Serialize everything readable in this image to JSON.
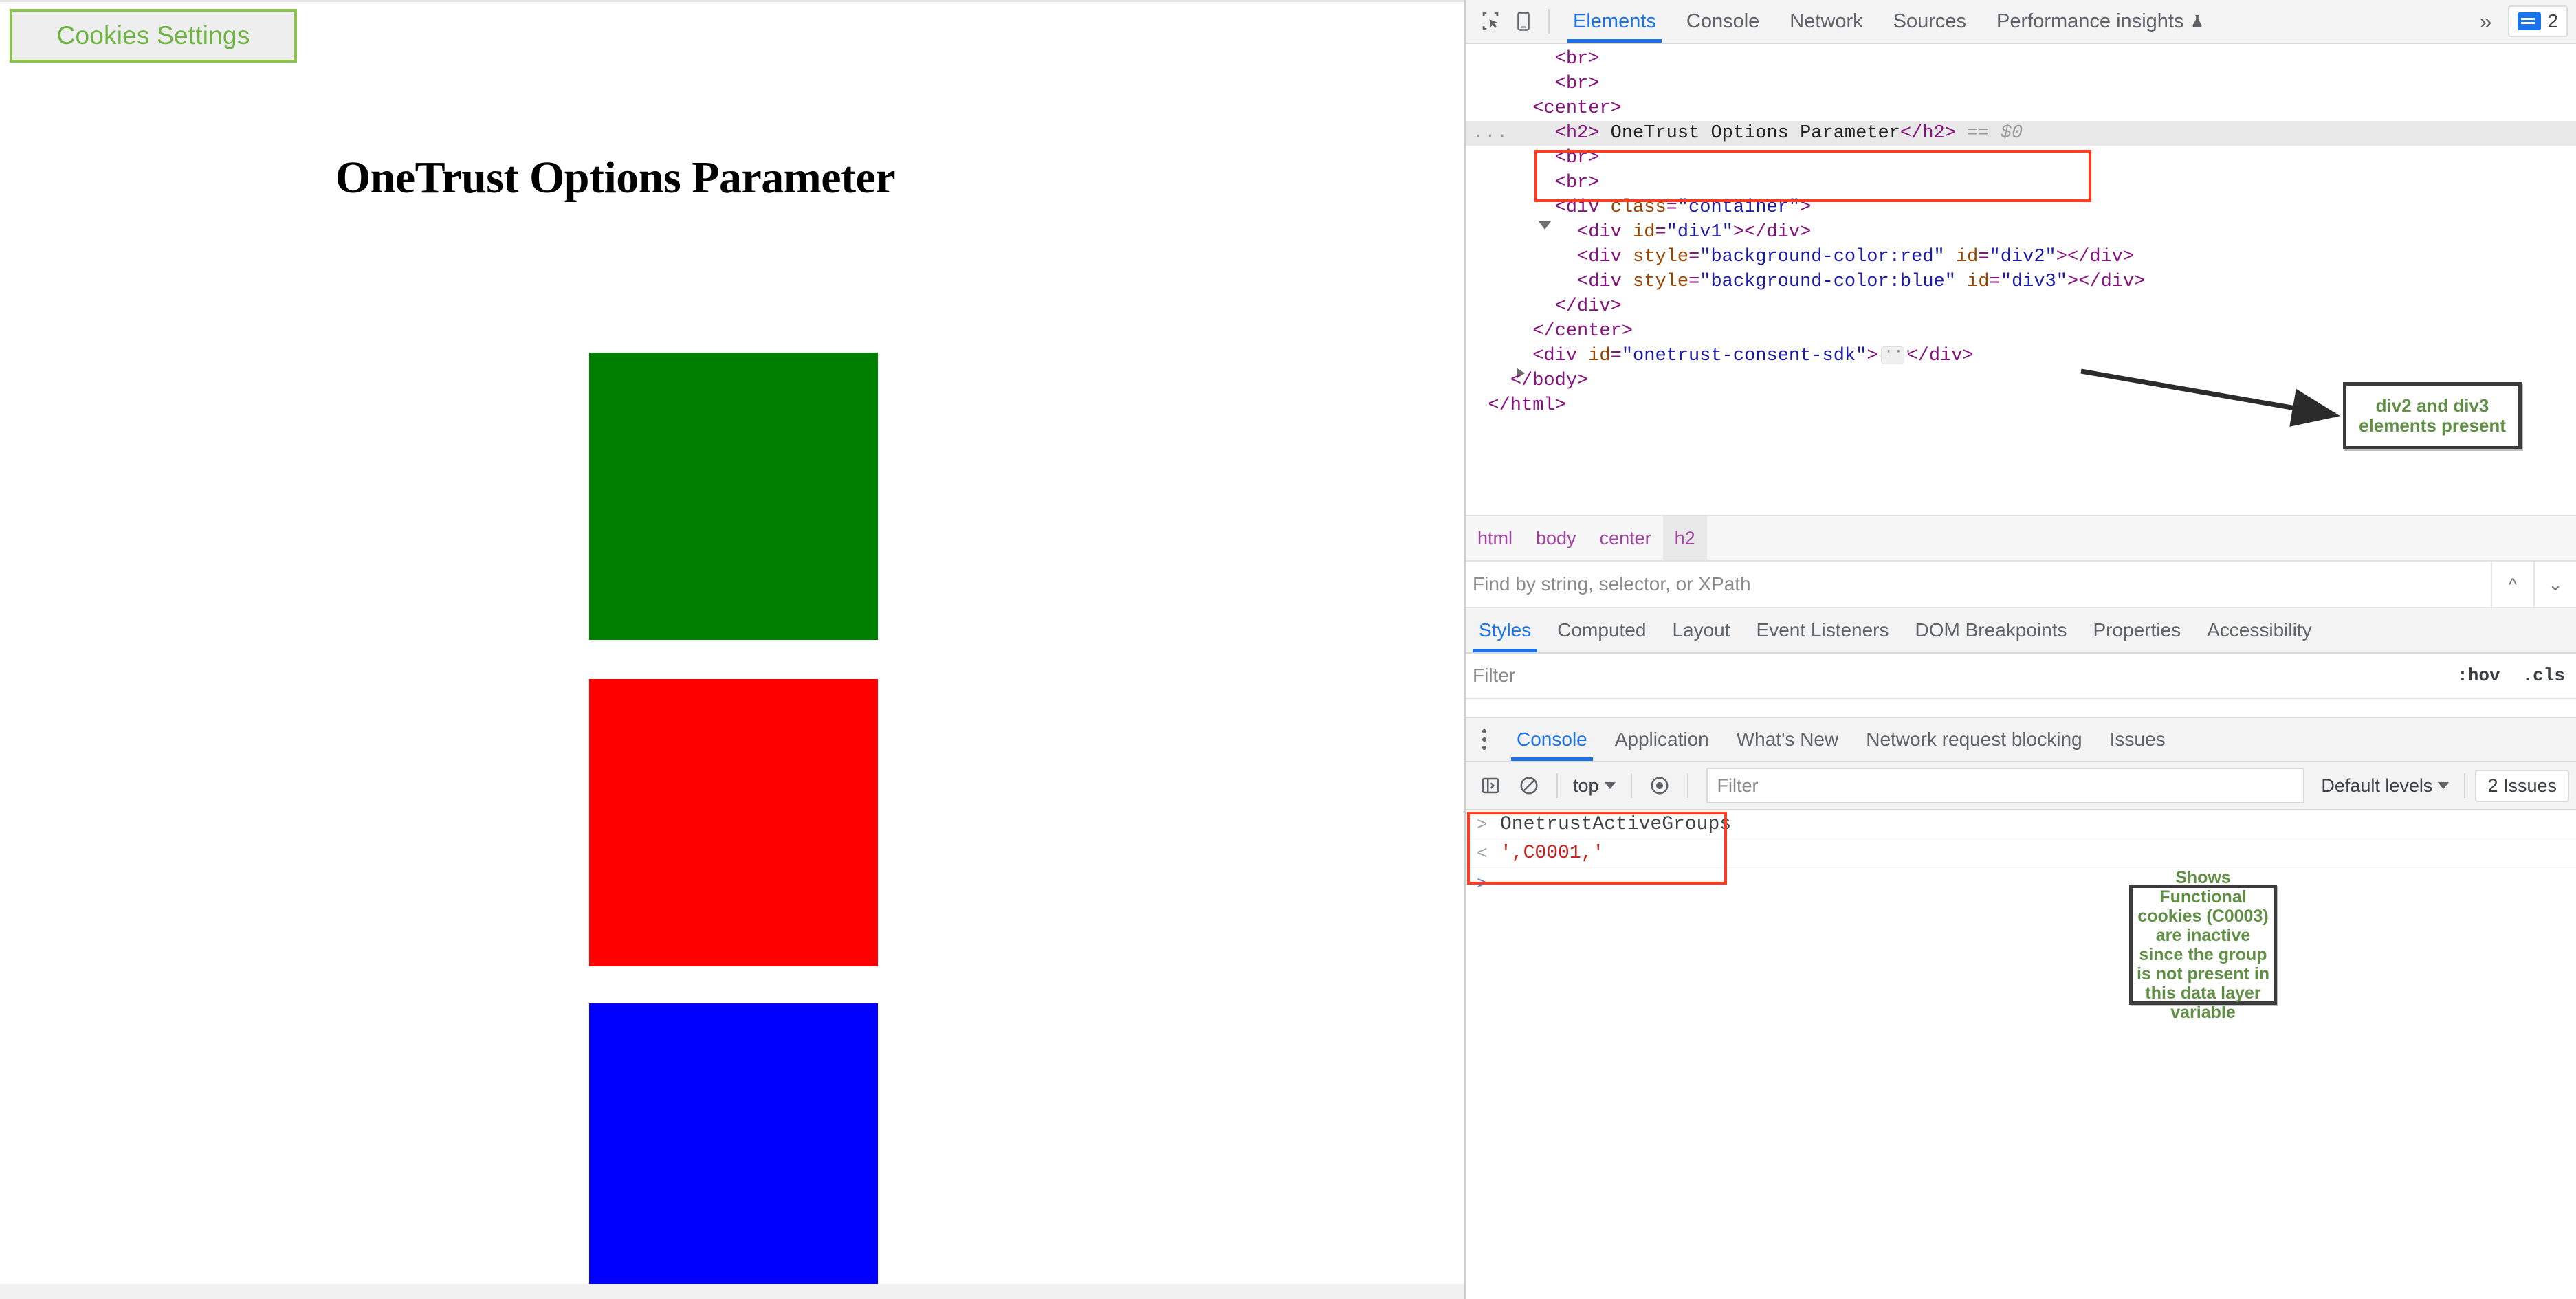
{
  "page": {
    "cookies_button_label": "Cookies Settings",
    "title": "OneTrust Options Parameter",
    "blocks": [
      {
        "id": "div1",
        "color": "#008000",
        "name": "green-block"
      },
      {
        "id": "div2",
        "color": "#ff0000",
        "name": "red-block"
      },
      {
        "id": "div3",
        "color": "#0000ff",
        "name": "blue-block"
      }
    ]
  },
  "devtools": {
    "toolbar": {
      "tabs": [
        {
          "label": "Elements",
          "active": true
        },
        {
          "label": "Console",
          "active": false
        },
        {
          "label": "Network",
          "active": false
        },
        {
          "label": "Sources",
          "active": false
        },
        {
          "label": "Performance insights",
          "active": false,
          "icon": "flask-icon"
        }
      ],
      "more_label": "»",
      "issues_count": "2"
    },
    "dom_tree": {
      "lines": [
        {
          "indent": 4,
          "html": "<span class=\"tg\">&lt;br&gt;</span>"
        },
        {
          "indent": 4,
          "html": "<span class=\"tg\">&lt;br&gt;</span>"
        },
        {
          "indent": 3,
          "triangle": "open",
          "html": "<span class=\"tg\">&lt;center&gt;</span>"
        },
        {
          "indent": 4,
          "selected": true,
          "ellipsis": true,
          "html": "<span class=\"tg\">&lt;h2&gt;</span> <span class=\"txt\">OneTrust Options Parameter</span><span class=\"tg\">&lt;/h2&gt;</span> <span class=\"gray\">== $0</span>"
        },
        {
          "indent": 4,
          "html": "<span class=\"tg\">&lt;br&gt;</span>"
        },
        {
          "indent": 4,
          "html": "<span class=\"tg\">&lt;br&gt;</span>"
        },
        {
          "indent": 4,
          "triangle": "open",
          "html": "<span class=\"tg\">&lt;div</span> <span class=\"at\">class</span>=<span class=\"av\">\"container\"</span><span class=\"tg\">&gt;</span>"
        },
        {
          "indent": 5,
          "html": "<span class=\"tg\">&lt;div</span> <span class=\"at\">id</span>=<span class=\"av\">\"div1\"</span><span class=\"tg\">&gt;&lt;/div&gt;</span>"
        },
        {
          "indent": 5,
          "html": "<span class=\"tg\">&lt;div</span> <span class=\"at\">style</span>=<span class=\"av\">\"background-color:red\"</span> <span class=\"at\">id</span>=<span class=\"av\">\"div2\"</span><span class=\"tg\">&gt;&lt;/div&gt;</span>"
        },
        {
          "indent": 5,
          "html": "<span class=\"tg\">&lt;div</span> <span class=\"at\">style</span>=<span class=\"av\">\"background-color:blue\"</span> <span class=\"at\">id</span>=<span class=\"av\">\"div3\"</span><span class=\"tg\">&gt;&lt;/div&gt;</span>"
        },
        {
          "indent": 4,
          "html": "<span class=\"tg\">&lt;/div&gt;</span>"
        },
        {
          "indent": 3,
          "html": "<span class=\"tg\">&lt;/center&gt;</span>"
        },
        {
          "indent": 3,
          "triangle": "closed",
          "html": "<span class=\"tg\">&lt;div</span> <span class=\"at\">id</span>=<span class=\"av\">\"onetrust-consent-sdk\"</span><span class=\"tg\">&gt;</span><span class=\"dots-badge\"></span><span class=\"tg\">&lt;/div&gt;</span>"
        },
        {
          "indent": 2,
          "html": "<span class=\"tg\">&lt;/body&gt;</span>"
        },
        {
          "indent": 1,
          "html": "<span class=\"tg\">&lt;/html&gt;</span>"
        }
      ]
    },
    "dom_annotation": "div2 and div3 elements present",
    "breadcrumb": [
      {
        "label": "html",
        "active": false
      },
      {
        "label": "body",
        "active": false
      },
      {
        "label": "center",
        "active": false
      },
      {
        "label": "h2",
        "active": true
      }
    ],
    "find": {
      "placeholder": "Find by string, selector, or XPath",
      "value": ""
    },
    "styles_tabs": [
      {
        "label": "Styles",
        "active": true
      },
      {
        "label": "Computed",
        "active": false
      },
      {
        "label": "Layout",
        "active": false
      },
      {
        "label": "Event Listeners",
        "active": false
      },
      {
        "label": "DOM Breakpoints",
        "active": false
      },
      {
        "label": "Properties",
        "active": false
      },
      {
        "label": "Accessibility",
        "active": false
      }
    ],
    "styles_filter": {
      "placeholder": "Filter",
      "value": ""
    },
    "styles_hov": ":hov",
    "styles_cls": ".cls",
    "drawer_tabs": [
      {
        "label": "Console",
        "active": true
      },
      {
        "label": "Application",
        "active": false
      },
      {
        "label": "What's New",
        "active": false
      },
      {
        "label": "Network request blocking",
        "active": false
      },
      {
        "label": "Issues",
        "active": false
      }
    ],
    "console_toolbar": {
      "context": "top",
      "filter_placeholder": "Filter",
      "filter_value": "",
      "levels": "Default levels",
      "issues": "2 Issues"
    },
    "console_log": {
      "input_prompt": ">",
      "input_text": "OnetrustActiveGroups",
      "result_prompt": "<",
      "result_text": "',C0001,'",
      "next_prompt": ">"
    },
    "console_annotation": "Shows Functional cookies (C0003) are inactive since the group is not present in this data layer variable"
  }
}
